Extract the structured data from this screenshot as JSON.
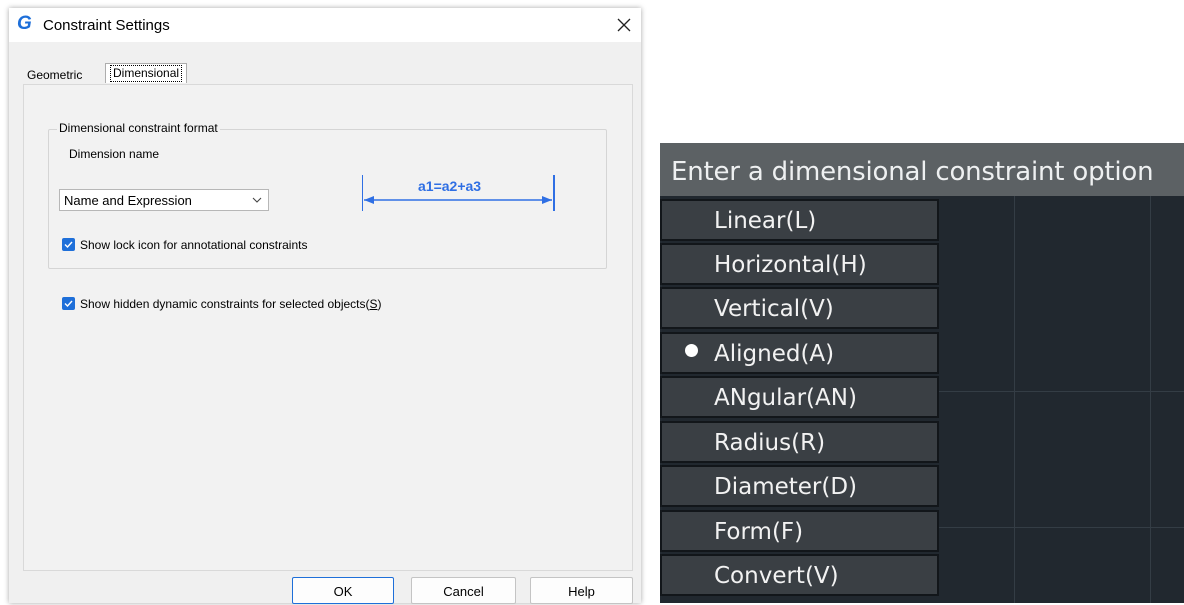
{
  "dialog": {
    "title": "Constraint Settings",
    "tabs": [
      "Geometric",
      "Dimensional"
    ],
    "active_tab": "Dimensional",
    "group_title": "Dimensional constraint format",
    "dimension_name_label": "Dimension name",
    "dimension_name_value": "Name and Expression",
    "preview_text": "a1=a2+a3",
    "show_lock_label": "Show lock icon for annotational constraints",
    "show_lock_checked": true,
    "show_hidden_label_prefix": "Show hidden dynamic constraints for selected objects(",
    "show_hidden_mnemonic": "S",
    "show_hidden_label_suffix": ")",
    "show_hidden_checked": true,
    "buttons": {
      "ok": "OK",
      "cancel": "Cancel",
      "help": "Help"
    },
    "accent_color": "#1e6fd9"
  },
  "command_menu": {
    "prompt": "Enter a dimensional constraint option",
    "items": [
      {
        "label": "Linear(L)",
        "selected": false
      },
      {
        "label": "Horizontal(H)",
        "selected": false
      },
      {
        "label": "Vertical(V)",
        "selected": false
      },
      {
        "label": "Aligned(A)",
        "selected": true
      },
      {
        "label": "ANgular(AN)",
        "selected": false
      },
      {
        "label": "Radius(R)",
        "selected": false
      },
      {
        "label": "Diameter(D)",
        "selected": false
      },
      {
        "label": "Form(F)",
        "selected": false
      },
      {
        "label": "Convert(V)",
        "selected": false
      }
    ],
    "background_color": "#21282f",
    "header_color": "#5c6164",
    "item_color": "#3a3f44"
  }
}
